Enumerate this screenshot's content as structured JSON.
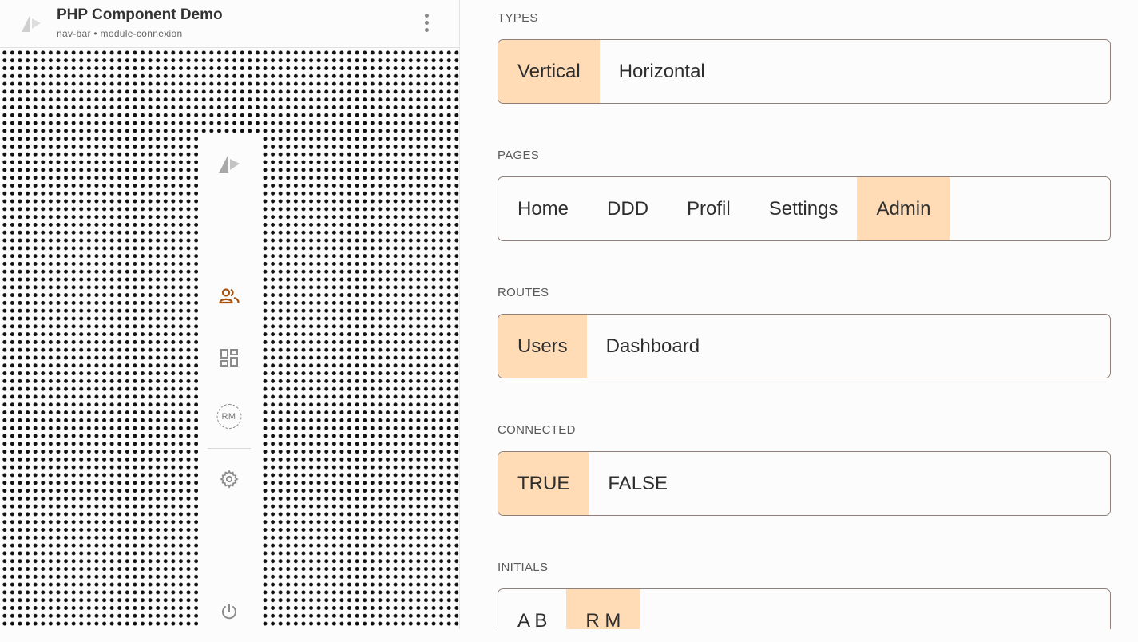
{
  "header": {
    "title": "PHP Component Demo",
    "subtitle": "nav-bar • module-connexion",
    "menu_icon": "more-vertical-icon",
    "logo_icon": "logo-icon"
  },
  "navbar": {
    "items": [
      {
        "name": "logo",
        "icon": "logo-icon",
        "active": false
      },
      {
        "name": "users",
        "icon": "users-icon",
        "active": true
      },
      {
        "name": "dashboard",
        "icon": "dashboard-icon",
        "active": false
      },
      {
        "name": "avatar",
        "icon": "avatar-icon",
        "label": "RM",
        "active": false
      },
      {
        "name": "settings",
        "icon": "gear-icon",
        "active": false
      },
      {
        "name": "logout",
        "icon": "power-icon",
        "active": false
      }
    ],
    "avatar_initials": "RM"
  },
  "colors": {
    "accent": "#ffdcb6",
    "active_icon": "#a5520e",
    "icon": "#8b8b8b",
    "border": "#8e8079"
  },
  "controls": {
    "types": {
      "label": "TYPES",
      "options": [
        "Vertical",
        "Horizontal"
      ],
      "selected": "Vertical"
    },
    "pages": {
      "label": "PAGES",
      "options": [
        "Home",
        "DDD",
        "Profil",
        "Settings",
        "Admin"
      ],
      "selected": "Admin"
    },
    "routes": {
      "label": "ROUTES",
      "options": [
        "Users",
        "Dashboard"
      ],
      "selected": "Users"
    },
    "connected": {
      "label": "CONNECTED",
      "options": [
        "TRUE",
        "FALSE"
      ],
      "selected": "TRUE"
    },
    "initials": {
      "label": "INITIALS",
      "options": [
        "A B",
        "R M"
      ],
      "selected": "R M"
    }
  }
}
